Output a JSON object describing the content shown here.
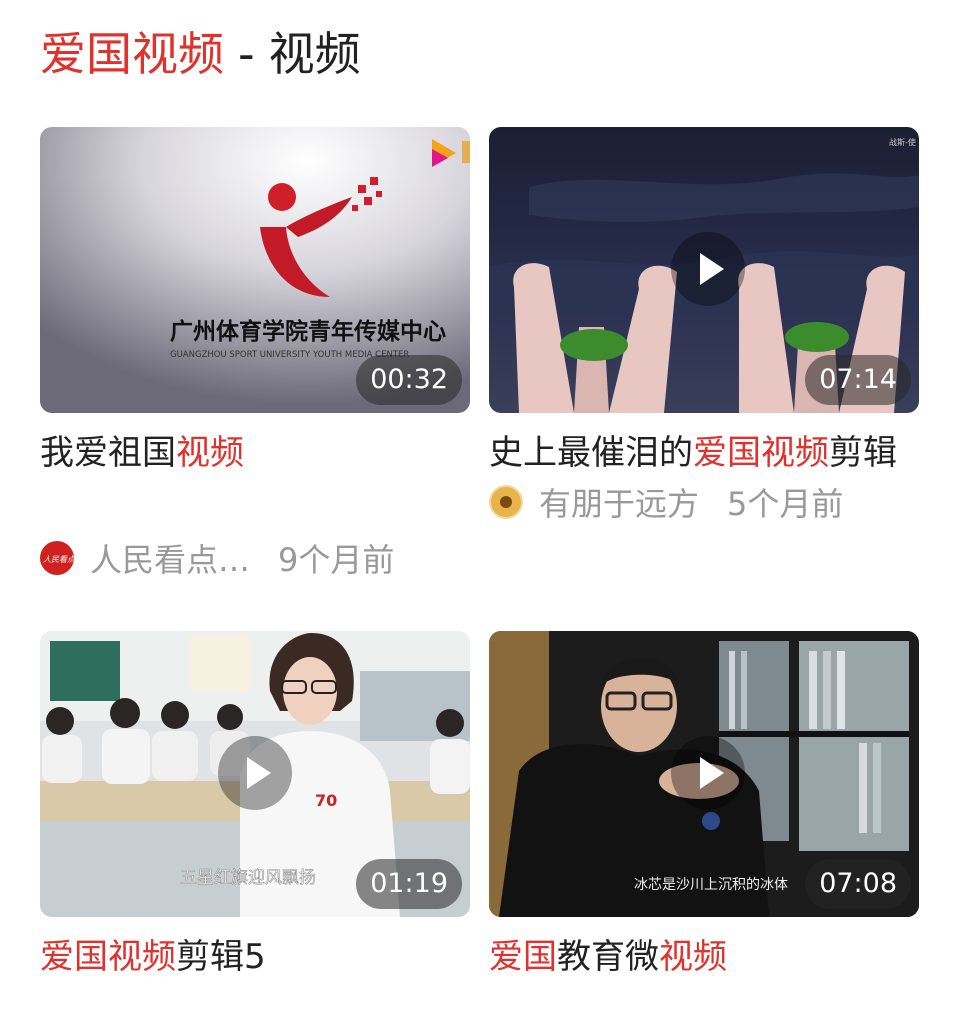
{
  "header": {
    "query": "爱国视频",
    "separator": "-",
    "section": "视频"
  },
  "videos": [
    {
      "title_parts": [
        {
          "text": "我爱祖国",
          "hl": false
        },
        {
          "text": "视频",
          "hl": true
        }
      ],
      "duration": "00:32",
      "thumb_text": "广州体育学院青年传媒中心",
      "thumb_subtext": "GUANGZHOU SPORT UNIVERSITY YOUTH MEDIA CENTER",
      "author": "人民看点…",
      "avatar_text": "人民看点",
      "time": "9个月前"
    },
    {
      "title_parts": [
        {
          "text": "史上最催泪的",
          "hl": false
        },
        {
          "text": "爱国视频",
          "hl": true
        },
        {
          "text": "剪辑",
          "hl": false
        }
      ],
      "duration": "07:14",
      "corner_text": "战斯-使",
      "author": "有朋于远方",
      "time": "5个月前"
    },
    {
      "title_parts": [
        {
          "text": "爱国视频",
          "hl": true
        },
        {
          "text": "剪辑5",
          "hl": false
        }
      ],
      "duration": "01:19",
      "caption": "五星红旗迎风飘扬",
      "badge_number": "70"
    },
    {
      "title_parts": [
        {
          "text": "爱国",
          "hl": true
        },
        {
          "text": "教育微",
          "hl": false
        },
        {
          "text": "视频",
          "hl": true
        }
      ],
      "duration": "07:08",
      "caption": "冰芯是沙川上沉积的冰体"
    }
  ],
  "colors": {
    "highlight": "#e0312c",
    "text": "#222222",
    "meta": "#999999"
  }
}
